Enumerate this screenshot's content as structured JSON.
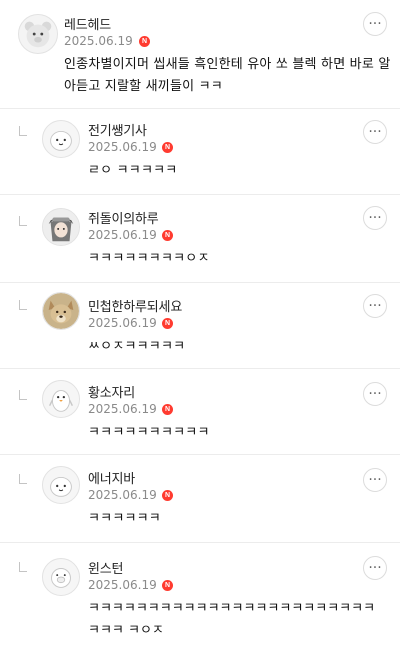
{
  "comments": [
    {
      "nickname": "레드헤드",
      "date": "2025.06.19",
      "badge": "N",
      "text": "인종차별이지머 씹새들 흑인한테 유아 쏘 블렉 하면 바로 알아듣고 지랄할 새끼들이 ㅋㅋ",
      "avatar_icon": "bear-avatar-icon",
      "is_reply": false
    },
    {
      "nickname": "전기쌩기사",
      "date": "2025.06.19",
      "badge": "N",
      "text": "ㄹㅇ ㅋㅋㅋㅋㅋ",
      "avatar_icon": "blob-avatar-icon",
      "is_reply": true
    },
    {
      "nickname": "쥐돌이의하루",
      "date": "2025.06.19",
      "badge": "N",
      "text": "ㅋㅋㅋㅋㅋㅋㅋㅋㅇㅈ",
      "avatar_icon": "anime-character-avatar-icon",
      "is_reply": true
    },
    {
      "nickname": "민첩한하루되세요",
      "date": "2025.06.19",
      "badge": "N",
      "text": "ㅆㅇㅈㅋㅋㅋㅋㅋ",
      "avatar_icon": "dog-photo-avatar-icon",
      "is_reply": true
    },
    {
      "nickname": "황소자리",
      "date": "2025.06.19",
      "badge": "N",
      "text": "ㅋㅋㅋㅋㅋㅋㅋㅋㅋㅋ",
      "avatar_icon": "penguin-avatar-icon",
      "is_reply": true
    },
    {
      "nickname": "에너지바",
      "date": "2025.06.19",
      "badge": "N",
      "text": "ㅋㅋㅋㅋㅋㅋ",
      "avatar_icon": "blob-avatar-icon",
      "is_reply": true
    },
    {
      "nickname": "윈스턴",
      "date": "2025.06.19",
      "badge": "N",
      "text": "ㅋㅋㅋㅋㅋㅋㅋㅋㅋㅋㅋㅋㅋㅋㅋㅋㅋㅋㅋㅋㅋㅋㅋㅋㅋㅋㅋ ㅋㅇㅈ",
      "avatar_icon": "pig-avatar-icon",
      "is_reply": true
    }
  ],
  "more_button_label": "···",
  "colors": {
    "badge": "#ff3b30",
    "date": "#8a8a8a",
    "divider": "#ececec"
  }
}
